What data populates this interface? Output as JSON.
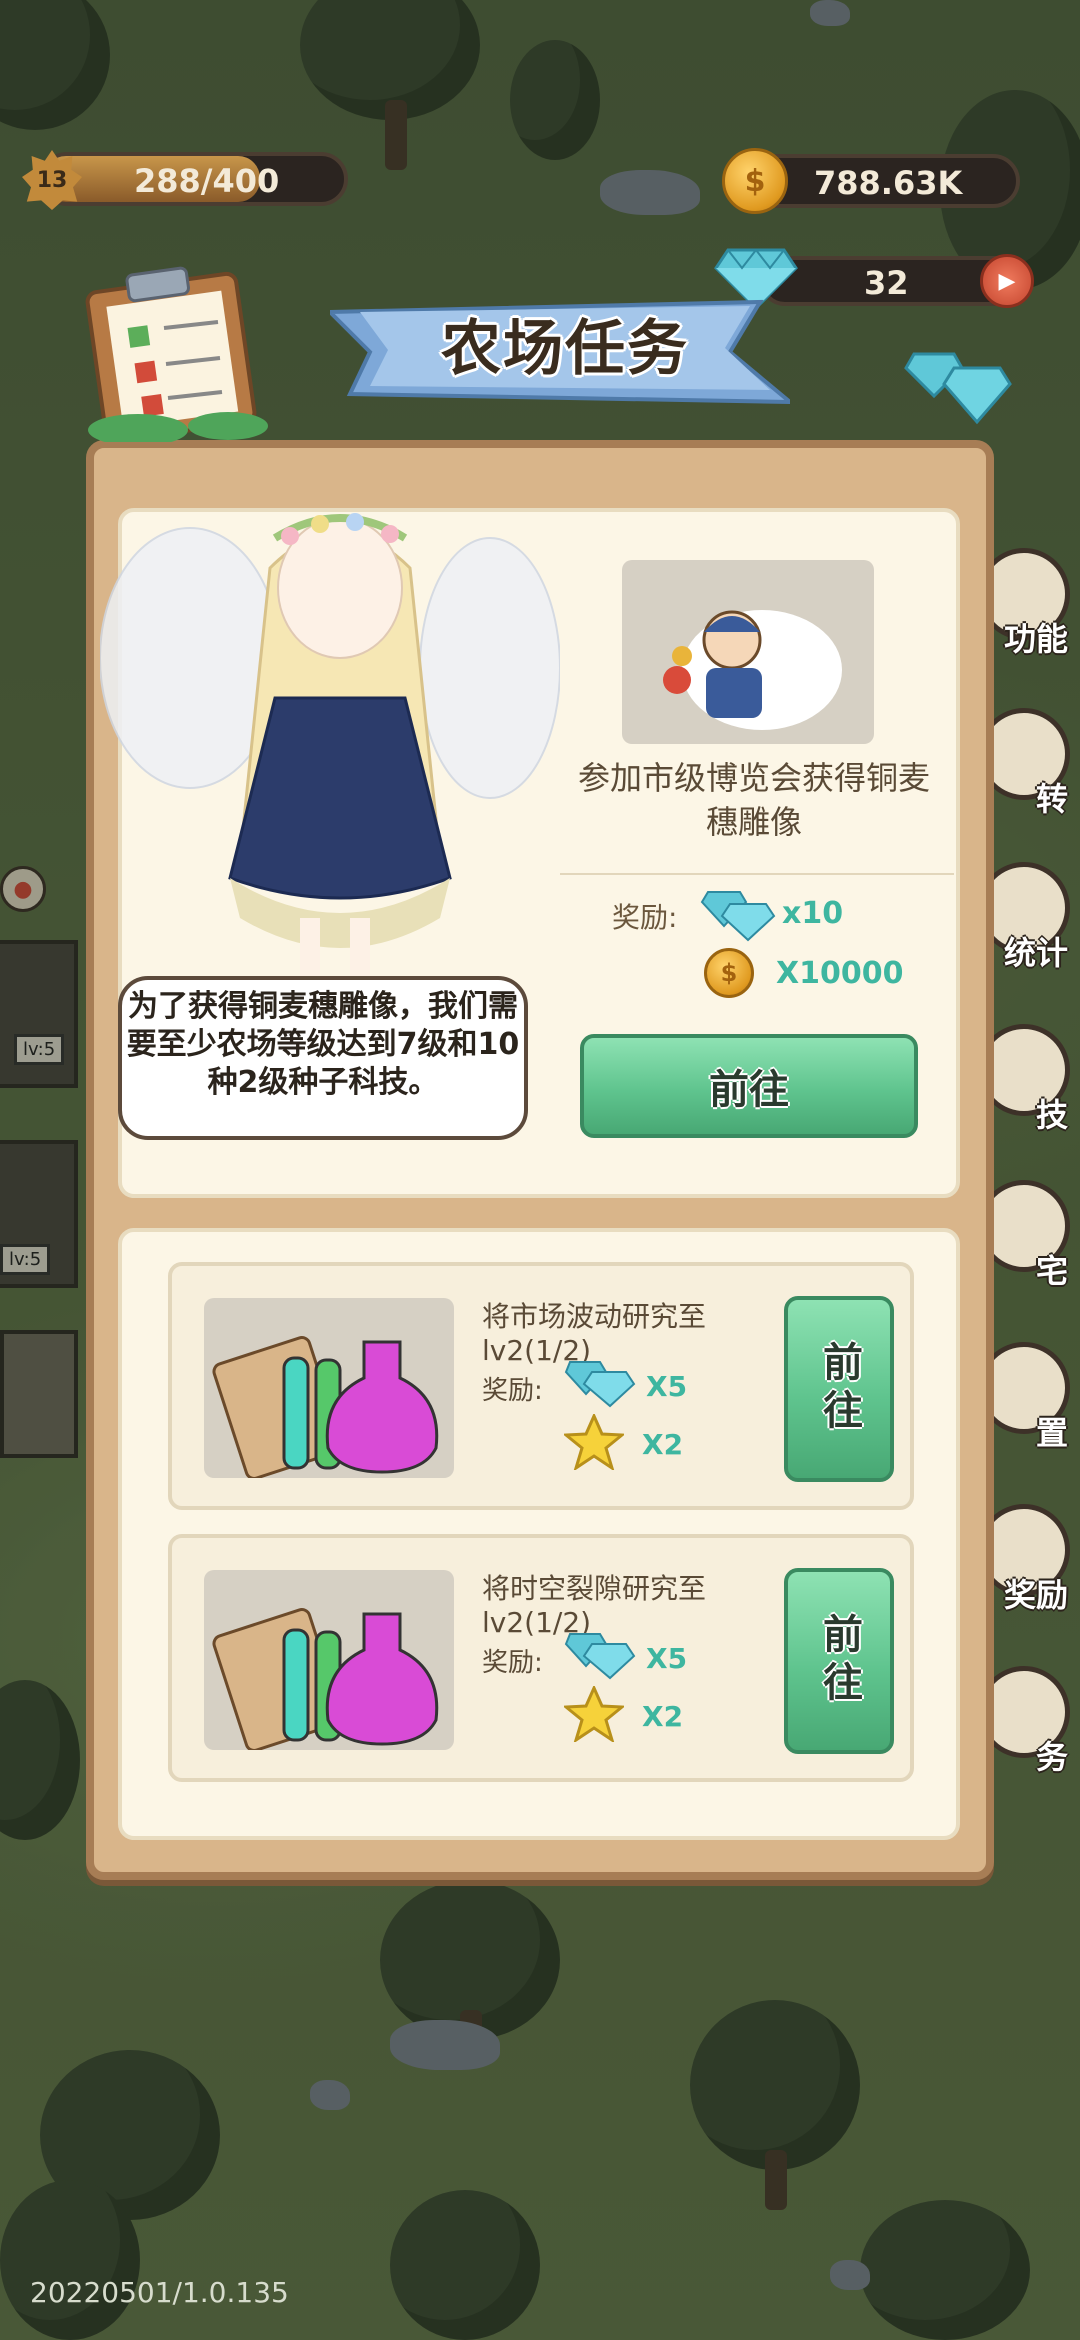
{
  "hud": {
    "level": "13",
    "exp": "288/400",
    "exp_progress": 0.72,
    "coins": "788.63K",
    "gems": "32"
  },
  "title": "农场任务",
  "main_task": {
    "description": "参加市级博览会获得铜麦穗雕像",
    "reward_label": "奖励:",
    "reward_gems": "x10",
    "reward_coins": "X10000",
    "go_label": "前往",
    "speech": "为了获得铜麦穗雕像，我们需要至少农场等级达到7级和10种2级种子科技。"
  },
  "subtasks": [
    {
      "description": "将市场波动研究至lv2(1/2)",
      "reward_label": "奖励:",
      "gems": "X5",
      "stars": "X2",
      "go_label": "前往"
    },
    {
      "description": "将时空裂隙研究至lv2(1/2)",
      "reward_label": "奖励:",
      "gems": "X5",
      "stars": "X2",
      "go_label": "前往"
    }
  ],
  "side_menu": [
    "功能",
    "转",
    "统计",
    "技",
    "宅",
    "置",
    "奖励",
    "务"
  ],
  "buildings": [
    "lv:5",
    "lv:5"
  ],
  "version": "20220501/1.0.135"
}
